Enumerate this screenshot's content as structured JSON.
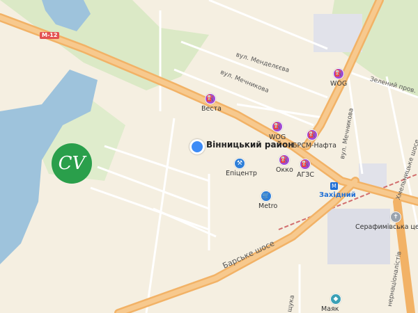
{
  "map": {
    "colors": {
      "land": "#f5efe1",
      "forest": "#dbe9c6",
      "water": "#9ec3dc",
      "major_road": "#f2b266",
      "minor_road": "#ffffff",
      "poi_pin": "#a24ad4",
      "location_dot": "#3d8bf6",
      "railway": "#d16d6d"
    },
    "route_badge": "М-12",
    "district_label": "Вінницький район",
    "logo_text": "CV",
    "pois": {
      "vesta": "Веста",
      "wog_top": "WOG",
      "wog_mid": "WOG",
      "brsm": "БРСМ-Нафта",
      "okko": "Окко",
      "agzs": "АГЗС",
      "epicentr": "Епіцентр",
      "metro": "Metro",
      "zakhidnyi": "Західний",
      "serafymivska": "Серафимівська церк",
      "mayak": "Маяк"
    },
    "streets": {
      "mendeleieva": "вул. Менделєєва",
      "mechnykova_top": "вул. Мечникова",
      "zelenyi_prov": "Зелений пров.",
      "mechnykova_right": "вул. Мечникова",
      "khmelnytske": "Хмельницьке шосе",
      "barske": "Барське шосе",
      "internatsionalistiv": "нернаціоналістів",
      "shchuka": "щука"
    },
    "icons": {
      "fuel": "fuel-icon",
      "hardware": "hardware-store-icon",
      "cart": "shopping-cart-icon",
      "train": "train-station-icon",
      "church": "church-icon",
      "store": "store-icon"
    }
  }
}
